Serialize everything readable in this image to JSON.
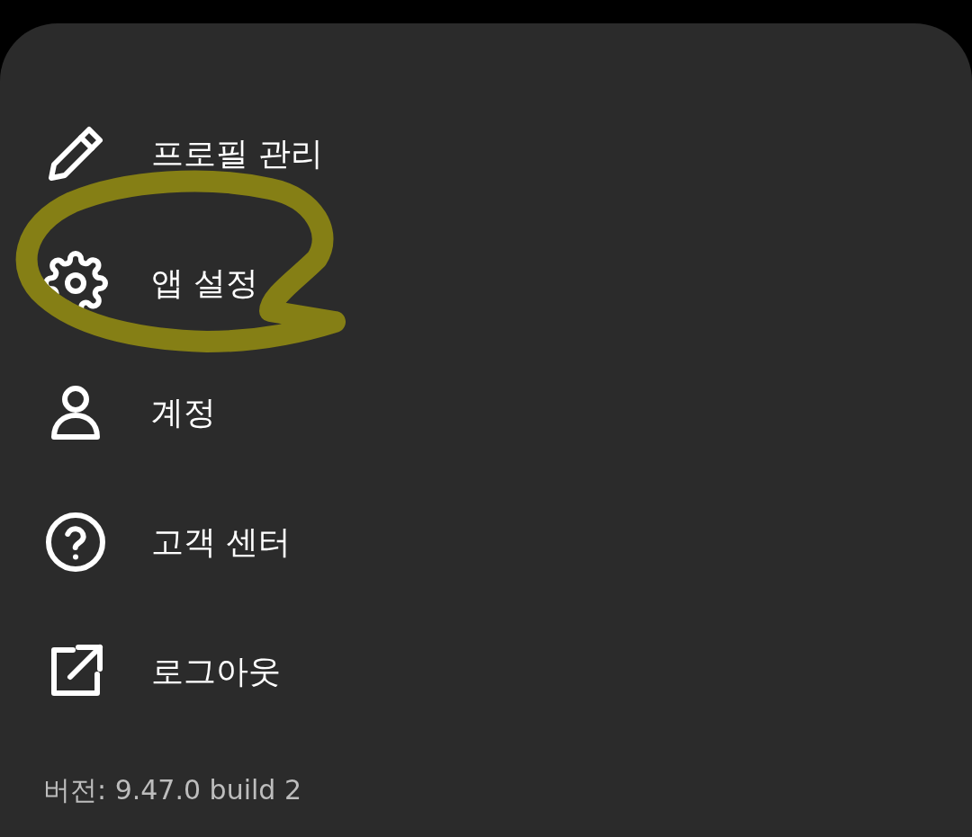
{
  "menu": {
    "items": [
      {
        "label": "프로필 관리",
        "kind": "pencil"
      },
      {
        "label": "앱 설정",
        "kind": "gear"
      },
      {
        "label": "계정",
        "kind": "person"
      },
      {
        "label": "고객 센터",
        "kind": "help"
      },
      {
        "label": "로그아웃",
        "kind": "external"
      }
    ]
  },
  "version": "버전: 9.47.0 build 2"
}
